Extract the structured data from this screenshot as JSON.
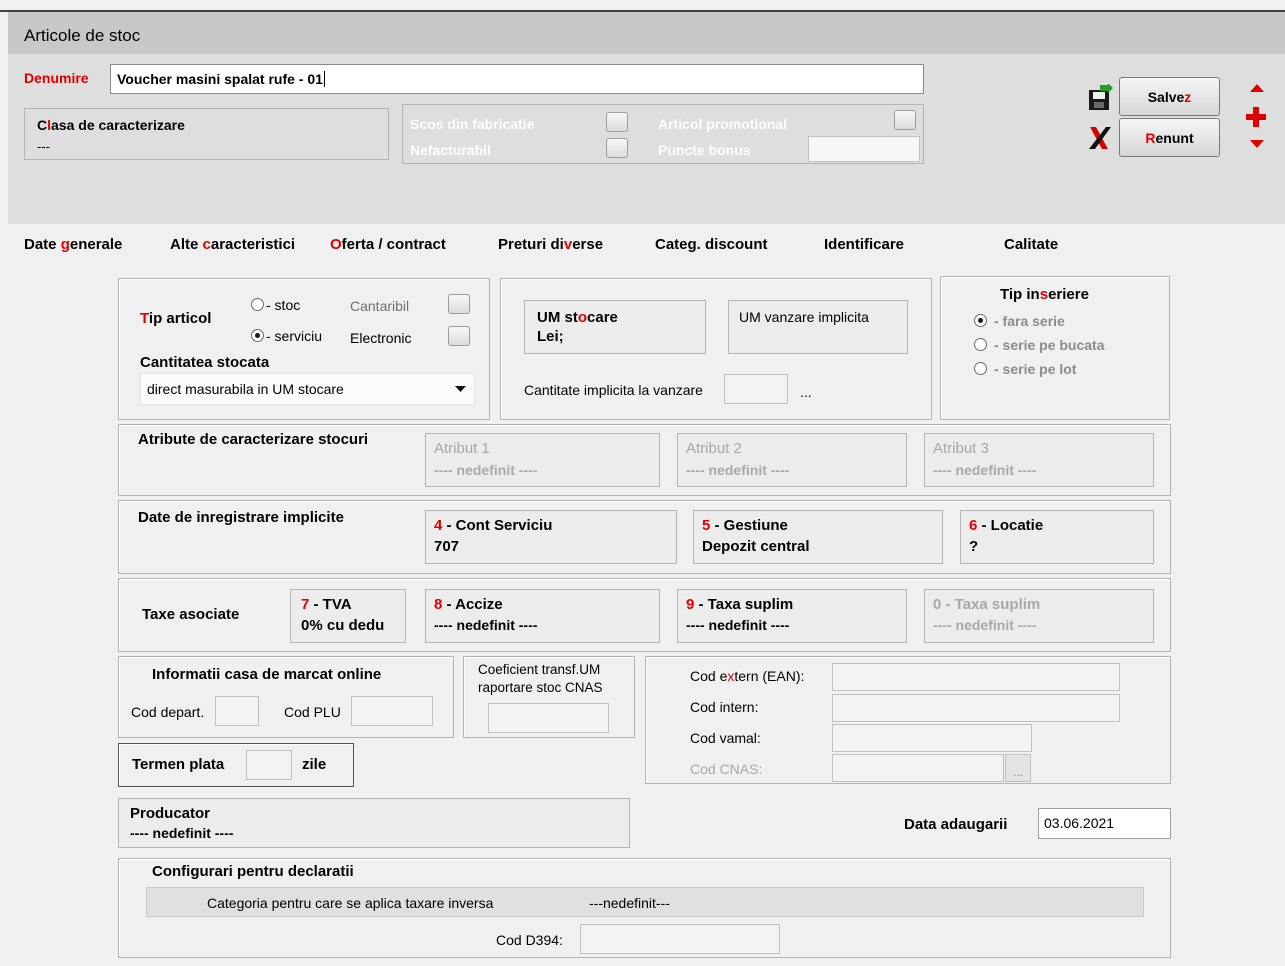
{
  "window": {
    "title": "Articole de stoc"
  },
  "denumire": {
    "label_hot": "D",
    "label_rest": "enumire",
    "value": "Voucher masini spalat rufe - 01"
  },
  "clasa": {
    "label_pre": "C",
    "label_hot": "l",
    "label_rest": "asa de caracterizare",
    "value": "---"
  },
  "flags": {
    "scos_din_fabricatie": "Scos din fabricatie",
    "nefacturabil": "Nefacturabil",
    "articol_promotional": "Articol promotional",
    "puncte_bonus": "Puncte bonus"
  },
  "buttons": {
    "save_pre": "Salve",
    "save_hot": "z",
    "cancel_hot": "R",
    "cancel_rest": "enunt"
  },
  "tabs": [
    {
      "pre": "Date ",
      "hot": "g",
      "post": "enerale"
    },
    {
      "pre": "Alte ",
      "hot": "c",
      "post": "aracteristici"
    },
    {
      "pre": "",
      "hot": "O",
      "post": "ferta / contract"
    },
    {
      "pre": "Preturi di",
      "hot": "v",
      "post": "erse"
    },
    {
      "pre": "Categ. discount",
      "hot": "",
      "post": ""
    },
    {
      "pre": "Identificare",
      "hot": "",
      "post": ""
    },
    {
      "pre": "Calitate",
      "hot": "",
      "post": ""
    }
  ],
  "tip_articol": {
    "label_hot": "T",
    "label_rest": "ip articol",
    "option_stoc": "- stoc",
    "option_serviciu": "- serviciu",
    "selected": "serviciu",
    "cantaribil": "Cantaribil",
    "electronic": "Electronic",
    "cantitatea_label": "Cantitatea stocata",
    "cantitatea_value": "direct masurabila in UM stocare"
  },
  "um": {
    "stocare_pre": "UM st",
    "stocare_hot": "o",
    "stocare_post": "care",
    "stocare_value": "Lei;",
    "vanzare_label": "UM vanzare implicita",
    "cantitate_label": "Cantitate implicita la vanzare",
    "ellipsis": "..."
  },
  "tip_inseriere": {
    "title_pre": "Tip in",
    "title_hot": "s",
    "title_post": "eriere",
    "options": [
      "- fara serie",
      "- serie pe bucata",
      "- serie pe lot"
    ],
    "selected": 0
  },
  "atribute": {
    "title": "Atribute de caracterizare stocuri",
    "items": [
      {
        "label": "Atribut 1",
        "value": "---- nedefinit ----"
      },
      {
        "label": "Atribut 2",
        "value": "---- nedefinit ----"
      },
      {
        "label": "Atribut 3",
        "value": "---- nedefinit ----"
      }
    ]
  },
  "inregistrare": {
    "title": "Date de inregistrare implicite",
    "items": [
      {
        "num": "4",
        "label": " - Cont Serviciu",
        "value": "707"
      },
      {
        "num": "5",
        "label": " - Gestiune",
        "value": "Depozit central"
      },
      {
        "num": "6",
        "label": " - Locatie",
        "value": "?"
      }
    ]
  },
  "taxe": {
    "title": "Taxe asociate",
    "items": [
      {
        "num": "7",
        "label": " - TVA",
        "value": "0% cu dedu"
      },
      {
        "num": "8",
        "label": " - Accize",
        "value": "---- nedefinit ----"
      },
      {
        "num": "9",
        "label": " - Taxa suplim",
        "value": "---- nedefinit ----"
      },
      {
        "num": "0",
        "label": " - Taxa suplim",
        "value": "---- nedefinit ----"
      }
    ]
  },
  "casa_marcat": {
    "title": "Informatii casa de marcat online",
    "cod_depart": "Cod depart.",
    "cod_plu": "Cod PLU"
  },
  "coeficient": {
    "line1": "Coeficient transf.UM",
    "line2": "raportare stoc CNAS"
  },
  "coduri": {
    "ext_pre": "Cod e",
    "ext_hot": "x",
    "ext_post": "tern (EAN):",
    "intern": "Cod intern:",
    "vamal": "Cod vamal:",
    "cnas": "Cod CNAS:",
    "ellipsis": "..."
  },
  "termen": {
    "label": "Termen plata",
    "unit": "zile"
  },
  "producator": {
    "label": "Producator",
    "value": "---- nedefinit ----"
  },
  "data_adaugarii": {
    "label": "Data adaugarii",
    "value": "03.06.2021"
  },
  "declaratii": {
    "title": "Configurari pentru declaratii",
    "categoria_label": "Categoria pentru care se aplica taxare inversa",
    "categoria_value": "---nedefinit---",
    "cod_d394": "Cod D394:"
  }
}
